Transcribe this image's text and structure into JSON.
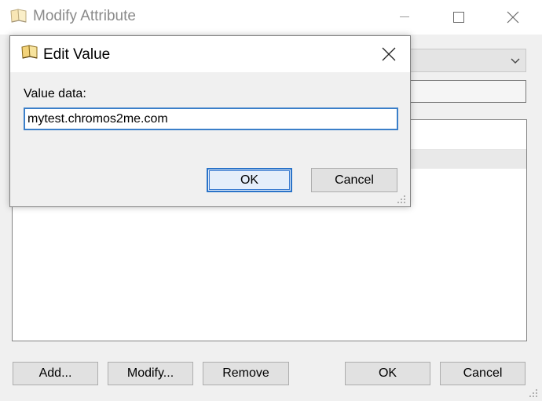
{
  "outer_window": {
    "title": "Modify Attribute",
    "buttons": {
      "add": "Add...",
      "modify": "Modify...",
      "remove": "Remove",
      "ok": "OK",
      "cancel": "Cancel"
    }
  },
  "dialog": {
    "title": "Edit Value",
    "value_label": "Value data:",
    "value": "mytest.chromos2me.com",
    "ok": "OK",
    "cancel": "Cancel"
  },
  "colors": {
    "focus_accent": "#2a73c8",
    "dialog_background": "#f0f0f0",
    "titlebar_background": "#ffffff"
  },
  "icons": {
    "window_icon": "book-icon",
    "dialog_icon": "book-icon"
  }
}
